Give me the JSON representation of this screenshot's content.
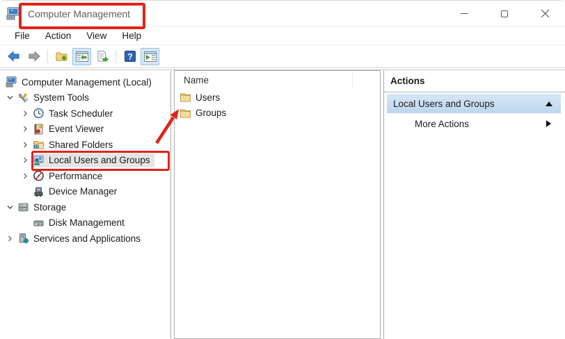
{
  "window": {
    "title": "Computer Management",
    "app_icon": "computer-management-icon",
    "controls": [
      {
        "name": "minimize-icon"
      },
      {
        "name": "maximize-icon"
      },
      {
        "name": "close-icon"
      }
    ]
  },
  "menu": {
    "items": [
      {
        "label": "File"
      },
      {
        "label": "Action"
      },
      {
        "label": "View"
      },
      {
        "label": "Help"
      }
    ]
  },
  "toolbar": {
    "icons": [
      {
        "name": "back-arrow",
        "active": false
      },
      {
        "name": "forward-arrow",
        "active": false
      },
      {
        "name": "up-one-level-folder",
        "active": false
      },
      {
        "name": "show-console-tree",
        "active": true
      },
      {
        "name": "export-list",
        "active": false
      },
      {
        "name": "help",
        "active": false
      },
      {
        "name": "show-action-pane",
        "active": true
      }
    ]
  },
  "tree": {
    "items": [
      {
        "label": "Computer Management (Local)",
        "level": 0,
        "chevron": "none",
        "icon": "computer-icon"
      },
      {
        "label": "System Tools",
        "level": 1,
        "chevron": "expanded",
        "icon": "tools-icon"
      },
      {
        "label": "Task Scheduler",
        "level": 2,
        "chevron": "collapsed",
        "icon": "clock-icon"
      },
      {
        "label": "Event Viewer",
        "level": 2,
        "chevron": "collapsed",
        "icon": "event-log-icon"
      },
      {
        "label": "Shared Folders",
        "level": 2,
        "chevron": "collapsed",
        "icon": "shared-folder-icon"
      },
      {
        "label": "Local Users and Groups",
        "level": 2,
        "chevron": "collapsed",
        "icon": "users-icon",
        "selected": true,
        "annotated": true
      },
      {
        "label": "Performance",
        "level": 2,
        "chevron": "collapsed",
        "icon": "performance-icon"
      },
      {
        "label": "Device Manager",
        "level": 2,
        "chevron": "none",
        "icon": "device-manager-icon"
      },
      {
        "label": "Storage",
        "level": 1,
        "chevron": "expanded",
        "icon": "storage-icon"
      },
      {
        "label": "Disk Management",
        "level": 2,
        "chevron": "none",
        "icon": "disk-icon"
      },
      {
        "label": "Services and Applications",
        "level": 1,
        "chevron": "collapsed",
        "icon": "services-icon"
      }
    ]
  },
  "listing": {
    "column_header": "Name",
    "items": [
      {
        "label": "Users",
        "icon": "folder-icon"
      },
      {
        "label": "Groups",
        "icon": "folder-icon"
      }
    ]
  },
  "actions": {
    "title": "Actions",
    "group_label": "Local Users and Groups",
    "group_collapse_icon": "collapse-triangle-up",
    "more_label": "More Actions",
    "more_submenu_icon": "submenu-triangle-right"
  },
  "annotations": {
    "color": "#e0231c",
    "items": [
      {
        "type": "box",
        "target": "window-title"
      },
      {
        "type": "box",
        "target": "tree-item-local-users-and-groups"
      },
      {
        "type": "arrow",
        "target": "users-folder"
      }
    ]
  },
  "colors": {
    "annotation_red": "#e0231c",
    "selected_action_row_top": "#d7e7f6",
    "selected_action_row_bottom": "#bdd6ee",
    "tree_selection_gray": "#e5e5e5",
    "toolbar_active_bg": "#d5e6f5",
    "toolbar_active_border": "#9ac2e2",
    "pane_border": "#acacac"
  }
}
